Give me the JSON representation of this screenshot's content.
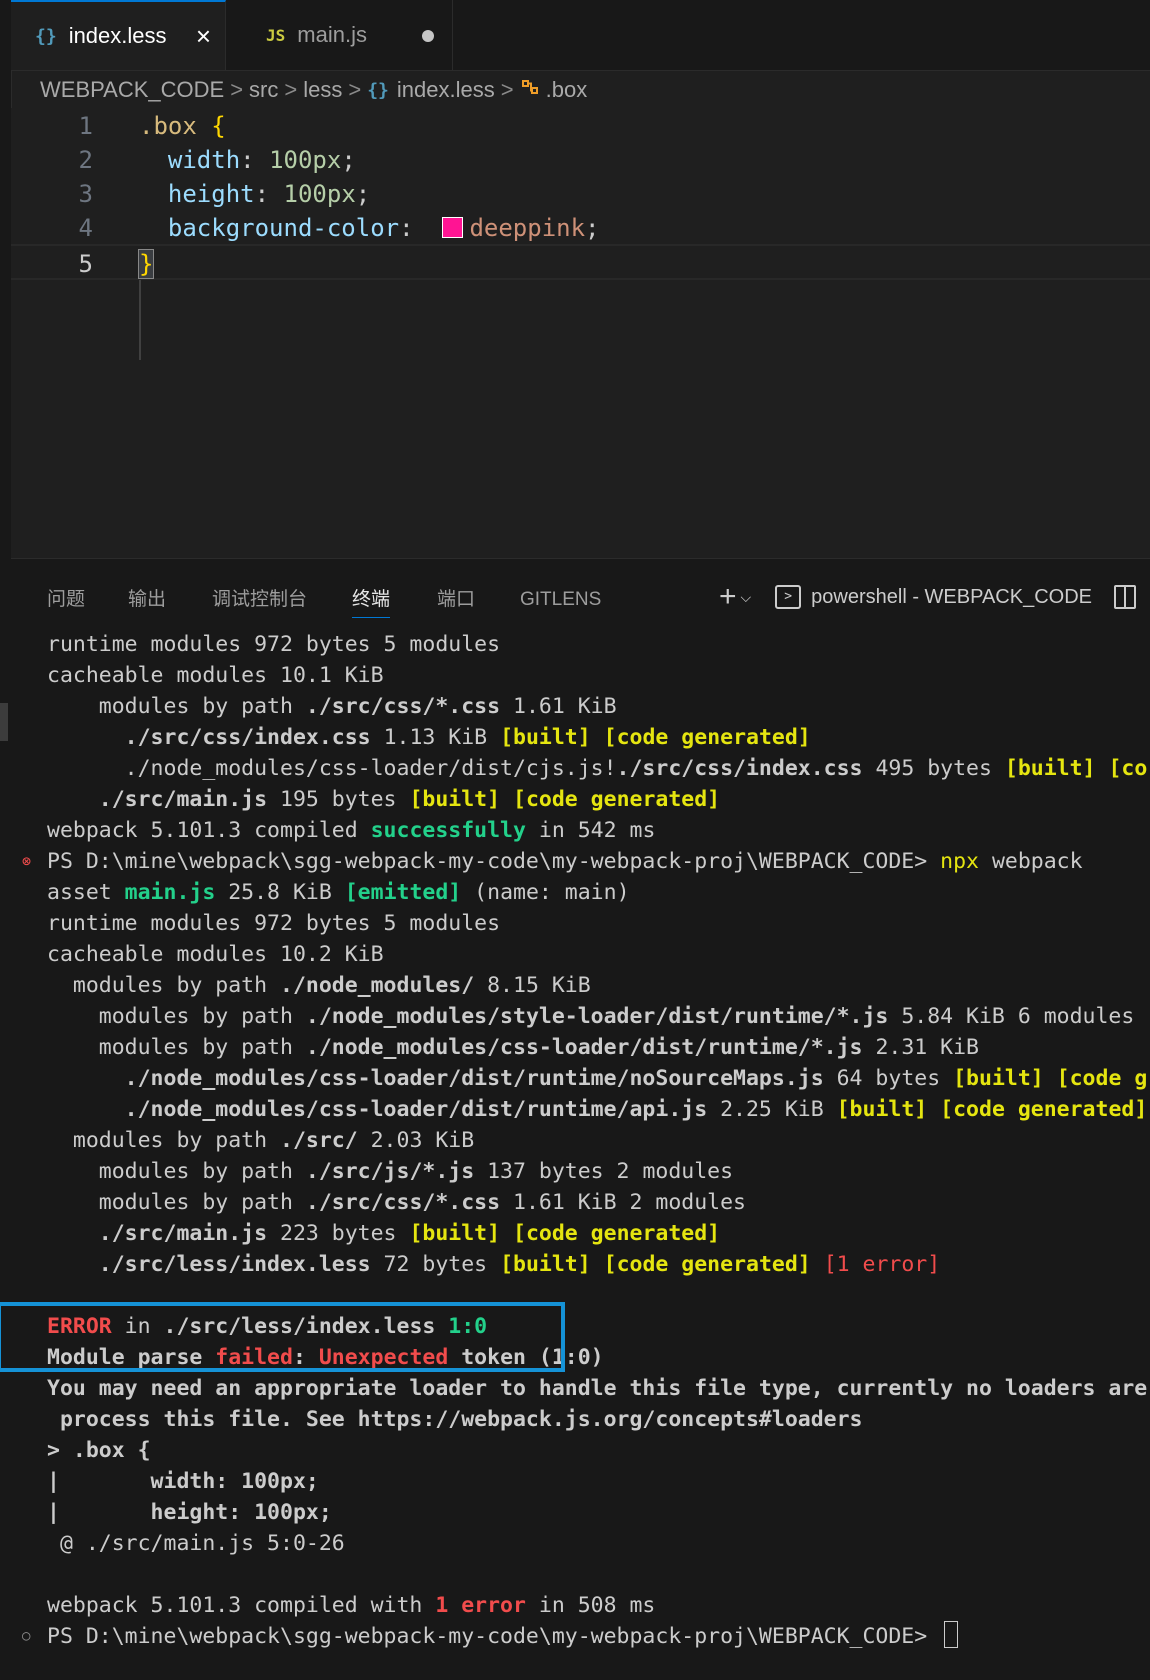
{
  "tabs": [
    {
      "icon": "{}",
      "label": "index.less",
      "close": "×"
    },
    {
      "icon": "JS",
      "label": "main.js"
    }
  ],
  "breadcrumb": {
    "items": [
      "WEBPACK_CODE",
      "src",
      "less",
      "index.less",
      ".box"
    ],
    "separator": ">",
    "file_icon": "{}"
  },
  "editor": {
    "lines": [
      {
        "num": "1",
        "selector": ".box",
        "brace": "{"
      },
      {
        "num": "2",
        "prop": "width",
        "value": "100px"
      },
      {
        "num": "3",
        "prop": "height",
        "value": "100px"
      },
      {
        "num": "4",
        "prop": "background-color",
        "value": "deeppink",
        "swatch_color": "#ff1493"
      },
      {
        "num": "5",
        "brace": "}"
      }
    ],
    "colon": ":",
    "semicolon": ";"
  },
  "panel": {
    "tabs": [
      "问题",
      "输出",
      "调试控制台",
      "终端",
      "端口",
      "GITLENS"
    ],
    "active_tab": "终端",
    "add": "+",
    "dropdown": "⌵",
    "shell_label": "powershell - WEBPACK_CODE"
  },
  "terminal": {
    "l1": "runtime modules 972 bytes 5 modules",
    "l2": "cacheable modules 10.1 KiB",
    "l3a": "    modules by path ",
    "l3b": "./src/css/*.css",
    "l3c": " 1.61 KiB",
    "l4a": "      ",
    "l4b": "./src/css/index.css",
    "l4c": " 1.13 KiB ",
    "l4d": "[built]",
    "l4e": " ",
    "l4f": "[code generated]",
    "l5a": "      ./node_modules/css-loader/dist/cjs.js!",
    "l5b": "./src/css/index.css",
    "l5c": " 495 bytes ",
    "l5d": "[built]",
    "l5e": " ",
    "l5f": "[co",
    "l6a": "    ",
    "l6b": "./src/main.js",
    "l6c": " 195 bytes ",
    "l6d": "[built]",
    "l6e": " ",
    "l6f": "[code generated]",
    "l7a": "webpack 5.101.3 compiled ",
    "l7b": "successfully",
    "l7c": " in 542 ms",
    "l8a": "PS D:\\mine\\webpack\\sgg-webpack-my-code\\my-webpack-proj\\WEBPACK_CODE> ",
    "l8b": "npx",
    "l8c": " webpack",
    "l9a": "asset ",
    "l9b": "main.js",
    "l9c": " 25.8 KiB ",
    "l9d": "[emitted]",
    "l9e": " (name: main)",
    "l10": "runtime modules 972 bytes 5 modules",
    "l11": "cacheable modules 10.2 KiB",
    "l12a": "  modules by path ",
    "l12b": "./node_modules/",
    "l12c": " 8.15 KiB",
    "l13a": "    modules by path ",
    "l13b": "./node_modules/style-loader/dist/runtime/*.js",
    "l13c": " 5.84 KiB 6 modules",
    "l14a": "    modules by path ",
    "l14b": "./node_modules/css-loader/dist/runtime/*.js",
    "l14c": " 2.31 KiB",
    "l15a": "      ",
    "l15b": "./node_modules/css-loader/dist/runtime/noSourceMaps.js",
    "l15c": " 64 bytes ",
    "l15d": "[built]",
    "l15e": " ",
    "l15f": "[code g",
    "l16a": "      ",
    "l16b": "./node_modules/css-loader/dist/runtime/api.js",
    "l16c": " 2.25 KiB ",
    "l16d": "[built]",
    "l16e": " ",
    "l16f": "[code generated]",
    "l17a": "  modules by path ",
    "l17b": "./src/",
    "l17c": " 2.03 KiB",
    "l18a": "    modules by path ",
    "l18b": "./src/js/*.js",
    "l18c": " 137 bytes 2 modules",
    "l19a": "    modules by path ",
    "l19b": "./src/css/*.css",
    "l19c": " 1.61 KiB 2 modules",
    "l20a": "    ",
    "l20b": "./src/main.js",
    "l20c": " 223 bytes ",
    "l20d": "[built]",
    "l20e": " ",
    "l20f": "[code generated]",
    "l21a": "    ",
    "l21b": "./src/less/index.less",
    "l21c": " 72 bytes ",
    "l21d": "[built]",
    "l21e": " ",
    "l21f": "[code generated]",
    "l21g": " ",
    "l21h": "[1 error]",
    "l23a": "ERROR",
    "l23b": " in ",
    "l23c": "./src/less/index.less",
    "l23d": " ",
    "l23e": "1:0",
    "l24a": "Module parse ",
    "l24b": "failed",
    "l24c": ": ",
    "l24d": "Unexpected",
    "l24e": " token (1:0)",
    "l25": "You may need an appropriate loader to handle this file type, currently no loaders are",
    "l26": " process this file. See https://webpack.js.org/concepts#loaders",
    "l27": "> .box {",
    "l28": "|       width: 100px;",
    "l29": "|       height: 100px;",
    "l30": " @ ./src/main.js 5:0-26",
    "l32a": "webpack 5.101.3 compiled with ",
    "l32b": "1 error",
    "l32c": " in 508 ms",
    "l33": "PS D:\\mine\\webpack\\sgg-webpack-my-code\\my-webpack-proj\\WEBPACK_CODE> ",
    "err_marker": "⊗",
    "ok_marker": "○"
  },
  "colors": {
    "accent": "#0078d4",
    "error_highlight_box": "#1592d6",
    "terminal_yellow": "#e5e510",
    "terminal_green": "#23d18b",
    "terminal_red": "#f14c4c",
    "swatch_deeppink": "#ff1493"
  }
}
